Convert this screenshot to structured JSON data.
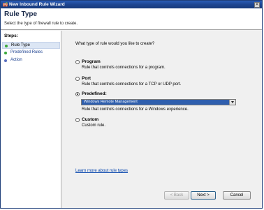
{
  "window": {
    "title": "New Inbound Rule Wizard",
    "close_glyph": "✕"
  },
  "header": {
    "title": "Rule Type",
    "subtitle": "Select the type of firewall rule to create."
  },
  "steps": {
    "title": "Steps:",
    "items": [
      {
        "label": "Rule Type",
        "current": true,
        "color": "#3aa83a"
      },
      {
        "label": "Predefined Rules",
        "current": false,
        "color": "#3aa83a"
      },
      {
        "label": "Action",
        "current": false,
        "color": "#5b6fbf"
      }
    ]
  },
  "main": {
    "question": "What type of rule would you like to create?",
    "options": [
      {
        "label": "Program",
        "desc": "Rule that controls connections for a program.",
        "checked": false
      },
      {
        "label": "Port",
        "desc": "Rule that controls connections for a TCP or UDP port.",
        "checked": false
      },
      {
        "label": "Predefined:",
        "desc": "Rule that controls connections for a Windows experience.",
        "checked": true
      },
      {
        "label": "Custom",
        "desc": "Custom rule.",
        "checked": false
      }
    ],
    "predefined_select": {
      "selected": "Windows Remote Management"
    },
    "learn_more_link": "Learn more about rule types"
  },
  "buttons": {
    "back": "< Back",
    "next": "Next >",
    "cancel": "Cancel"
  },
  "colors": {
    "titlebar": "#1d4591",
    "selection": "#2f5fae",
    "link": "#0645ad"
  }
}
